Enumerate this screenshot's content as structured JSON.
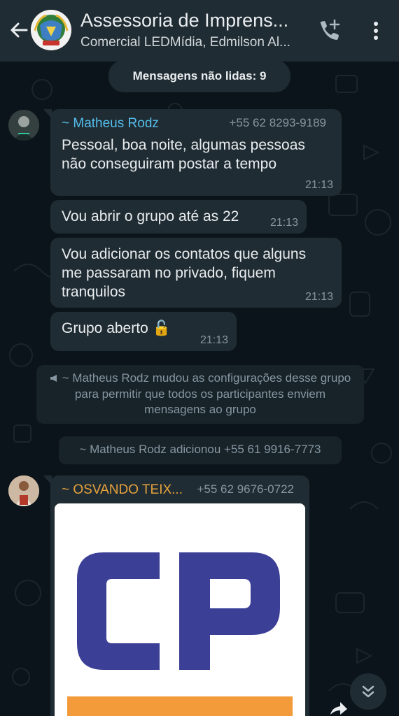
{
  "header": {
    "title": "Assessoria de Imprens...",
    "subtitle": "Comercial LEDMídia, Edmilson Al...",
    "back_icon": "arrow-left-icon",
    "call_icon": "add-call-icon",
    "menu_icon": "more-vert-icon"
  },
  "unread": {
    "label": "Mensagens não lidas: 9"
  },
  "messages": [
    {
      "sender": "~ Matheus Rodz",
      "sender_color": "#53bdeb",
      "phone": "+55 62 8293-9189",
      "text": "Pessoal, boa noite, algumas pessoas não conseguiram postar a tempo",
      "time": "21:13"
    },
    {
      "text": "Vou abrir o grupo até as 22",
      "time": "21:13"
    },
    {
      "text": "Vou adicionar os contatos que alguns me passaram no privado, fiquem tranquilos",
      "time": "21:13"
    },
    {
      "text": "Grupo aberto 🔓",
      "time": "21:13"
    }
  ],
  "system_messages": [
    {
      "text": "~ Matheus Rodz mudou as configurações desse grupo para permitir que todos os participantes enviem mensagens ao grupo"
    },
    {
      "text": "~ Matheus Rodz adicionou +55 61 9916-7773"
    }
  ],
  "image_message": {
    "sender": "~ OSVANDO TEIX...",
    "sender_color": "#e6a23c",
    "phone": "+55 62 9676-0722",
    "logo_text": "CP",
    "logo_color": "#3c3f96",
    "accent_color": "#f39a3a"
  },
  "colors": {
    "background": "#0b141a",
    "header": "#202c33",
    "bubble": "#202c33",
    "meta_text": "#8696a0"
  }
}
